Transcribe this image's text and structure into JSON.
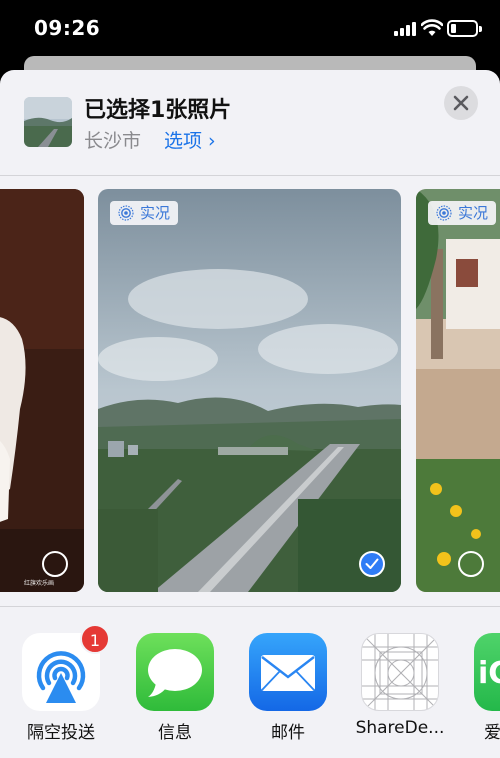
{
  "status_bar": {
    "time": "09:26"
  },
  "sheet": {
    "title": "已选择1张照片",
    "location": "长沙市",
    "options_label": "选项 ›"
  },
  "photos": {
    "left_watermark": "红旗欢乐画",
    "live_label": "实况"
  },
  "share_apps": [
    {
      "name": "airdrop",
      "label": "隔空投送",
      "badge": "1"
    },
    {
      "name": "messages",
      "label": "信息"
    },
    {
      "name": "mail",
      "label": "邮件"
    },
    {
      "name": "sharede",
      "label": "ShareDe..."
    },
    {
      "name": "icloud",
      "label": "爱"
    }
  ],
  "colors": {
    "accent": "#1a73e8",
    "badge": "#e53935",
    "sheet_bg": "#f2f2f6"
  }
}
